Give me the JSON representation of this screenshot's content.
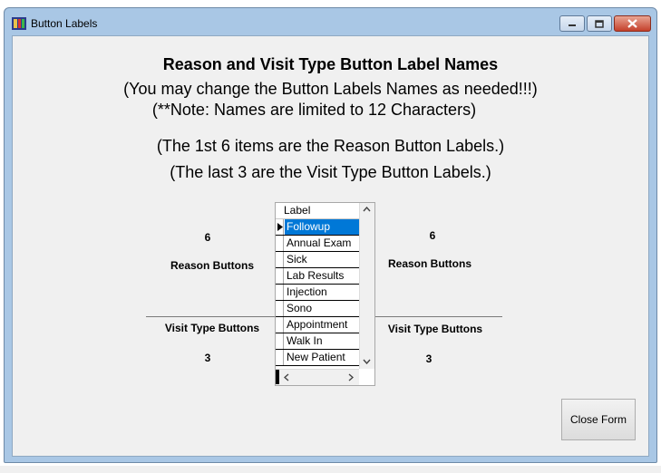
{
  "window": {
    "title": "Button Labels"
  },
  "form": {
    "heading": "Reason and Visit Type Button Label Names",
    "line1": "(You may change the Button Labels Names as needed!!!)",
    "line2": "(**Note: Names are limited to 12 Characters)",
    "line3": "(The 1st 6 items are the Reason Button Labels.)",
    "line4": "(The last 3 are the Visit Type Button Labels.)"
  },
  "left_panel": {
    "reason_count": "6",
    "reason_label": "Reason Buttons",
    "visit_label": "Visit Type Buttons",
    "visit_count": "3"
  },
  "right_panel": {
    "reason_count": "6",
    "reason_label": "Reason Buttons",
    "visit_label": "Visit Type Buttons",
    "visit_count": "3"
  },
  "grid": {
    "header": "Label",
    "rows": [
      "Followup",
      "Annual Exam",
      "Sick",
      "Lab Results",
      "Injection",
      "Sono",
      "Appointment",
      "Walk In",
      "New Patient"
    ],
    "selected_index": 0
  },
  "buttons": {
    "close_form": "Close Form"
  },
  "colors": {
    "selection": "#0078d7",
    "window_frame": "#a9c7e5",
    "client_bg": "#f0f0f0"
  }
}
